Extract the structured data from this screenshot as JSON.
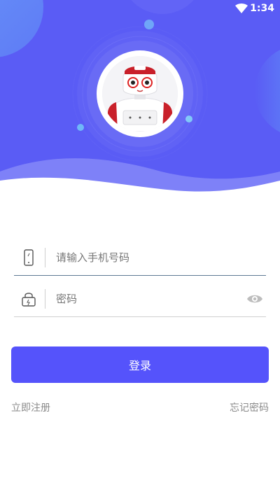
{
  "status_bar": {
    "time": "1:34"
  },
  "login_form": {
    "phone_placeholder": "请输入手机号码",
    "password_placeholder": "密码",
    "login_label": "登录",
    "register_label": "立即注册",
    "forgot_label": "忘记密码"
  },
  "colors": {
    "brand": "#5553fb",
    "header_bg": "#5a5cf5"
  },
  "icons": [
    "wifi-icon",
    "phone-icon",
    "lock-icon",
    "eye-icon",
    "robot-avatar"
  ]
}
